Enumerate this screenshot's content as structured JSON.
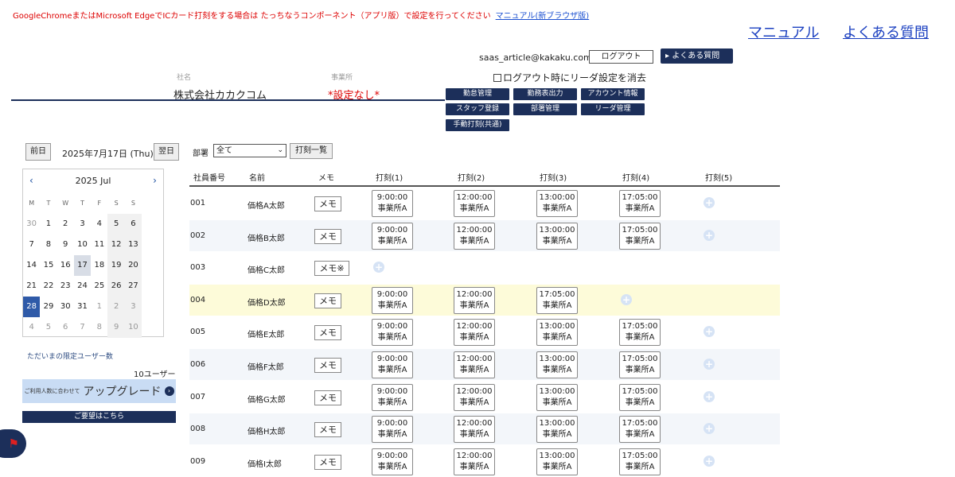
{
  "notice": {
    "text": "GoogleChromeまたはMicrosoft EdgeでICカード打刻をする場合は たっちなうコンポーネント（アプリ版）で設定を行ってください",
    "link": "マニュアル(新ブラウザ版)"
  },
  "top_links": {
    "manual": "マニュアル",
    "faq": "よくある質問"
  },
  "account": {
    "email": "saas_article@kakaku.com",
    "logout": "ログアウト",
    "faq_button": "よくある質問",
    "reader_reset_label": "ログアウト時にリーダ設定を消去"
  },
  "header": {
    "company_label": "社名",
    "company_value": "株式会社カカクコム",
    "office_label": "事業所",
    "office_value": "*設定なし*"
  },
  "nav": {
    "attendance": "勤怠管理",
    "report": "勤務表出力",
    "account_info": "アカウント情報",
    "staff": "スタッフ登録",
    "department": "部署管理",
    "reader": "リーダ管理",
    "manual_stamp": "手動打刻(共通)"
  },
  "date_nav": {
    "prev": "前日",
    "date": "2025年7月17日 (Thu)",
    "next": "翌日"
  },
  "calendar": {
    "month": "2025 Jul",
    "prev_arrow": "‹",
    "next_arrow": "›",
    "dow": [
      "M",
      "T",
      "W",
      "T",
      "F",
      "S",
      "S"
    ],
    "weeks": [
      [
        "30",
        "1",
        "2",
        "3",
        "4",
        "5",
        "6"
      ],
      [
        "7",
        "8",
        "9",
        "10",
        "11",
        "12",
        "13"
      ],
      [
        "14",
        "15",
        "16",
        "17",
        "18",
        "19",
        "20"
      ],
      [
        "21",
        "22",
        "23",
        "24",
        "25",
        "26",
        "27"
      ],
      [
        "28",
        "29",
        "30",
        "31",
        "1",
        "2",
        "3"
      ],
      [
        "4",
        "5",
        "6",
        "7",
        "8",
        "9",
        "10"
      ]
    ]
  },
  "sidebar": {
    "limit_label": "ただいまの限定ユーザー数",
    "limit_value": "10ユーザー",
    "upgrade_small": "ご利用人数に合わせて",
    "upgrade_label": "アップグレード",
    "upgrade_arrow": "›",
    "request_label": "ご要望はこちら"
  },
  "filter": {
    "dept_label": "部署",
    "dept_value": "全て",
    "list_button": "打刻一覧"
  },
  "table": {
    "headers": [
      "社員番号",
      "名前",
      "メモ",
      "打刻(1)",
      "打刻(2)",
      "打刻(3)",
      "打刻(4)",
      "打刻(5)"
    ],
    "rows": [
      {
        "id": "001",
        "name": "価格A太郎",
        "memo": "メモ",
        "stamps": [
          [
            "9:00:00",
            "事業所A"
          ],
          [
            "12:00:00",
            "事業所A"
          ],
          [
            "13:00:00",
            "事業所A"
          ],
          [
            "17:05:00",
            "事業所A"
          ]
        ]
      },
      {
        "id": "002",
        "name": "価格B太郎",
        "memo": "メモ",
        "stamps": [
          [
            "9:00:00",
            "事業所A"
          ],
          [
            "12:00:00",
            "事業所A"
          ],
          [
            "13:00:00",
            "事業所A"
          ],
          [
            "17:05:00",
            "事業所A"
          ]
        ]
      },
      {
        "id": "003",
        "name": "価格C太郎",
        "memo": "メモ※",
        "stamps": []
      },
      {
        "id": "004",
        "name": "価格D太郎",
        "memo": "メモ",
        "stamps": [
          [
            "9:00:00",
            "事業所A"
          ],
          [
            "12:00:00",
            "事業所A"
          ],
          [
            "17:05:00",
            "事業所A"
          ]
        ]
      },
      {
        "id": "005",
        "name": "価格E太郎",
        "memo": "メモ",
        "stamps": [
          [
            "9:00:00",
            "事業所A"
          ],
          [
            "12:00:00",
            "事業所A"
          ],
          [
            "13:00:00",
            "事業所A"
          ],
          [
            "17:05:00",
            "事業所A"
          ]
        ]
      },
      {
        "id": "006",
        "name": "価格F太郎",
        "memo": "メモ",
        "stamps": [
          [
            "9:00:00",
            "事業所A"
          ],
          [
            "12:00:00",
            "事業所A"
          ],
          [
            "13:00:00",
            "事業所A"
          ],
          [
            "17:05:00",
            "事業所A"
          ]
        ]
      },
      {
        "id": "007",
        "name": "価格G太郎",
        "memo": "メモ",
        "stamps": [
          [
            "9:00:00",
            "事業所A"
          ],
          [
            "12:00:00",
            "事業所A"
          ],
          [
            "13:00:00",
            "事業所A"
          ],
          [
            "17:05:00",
            "事業所A"
          ]
        ]
      },
      {
        "id": "008",
        "name": "価格H太郎",
        "memo": "メモ",
        "stamps": [
          [
            "9:00:00",
            "事業所A"
          ],
          [
            "12:00:00",
            "事業所A"
          ],
          [
            "13:00:00",
            "事業所A"
          ],
          [
            "17:05:00",
            "事業所A"
          ]
        ]
      },
      {
        "id": "009",
        "name": "価格I太郎",
        "memo": "メモ",
        "stamps": [
          [
            "9:00:00",
            "事業所A"
          ],
          [
            "12:00:00",
            "事業所A"
          ],
          [
            "13:00:00",
            "事業所A"
          ],
          [
            "17:05:00",
            "事業所A"
          ]
        ]
      }
    ],
    "add_icon": "+"
  }
}
